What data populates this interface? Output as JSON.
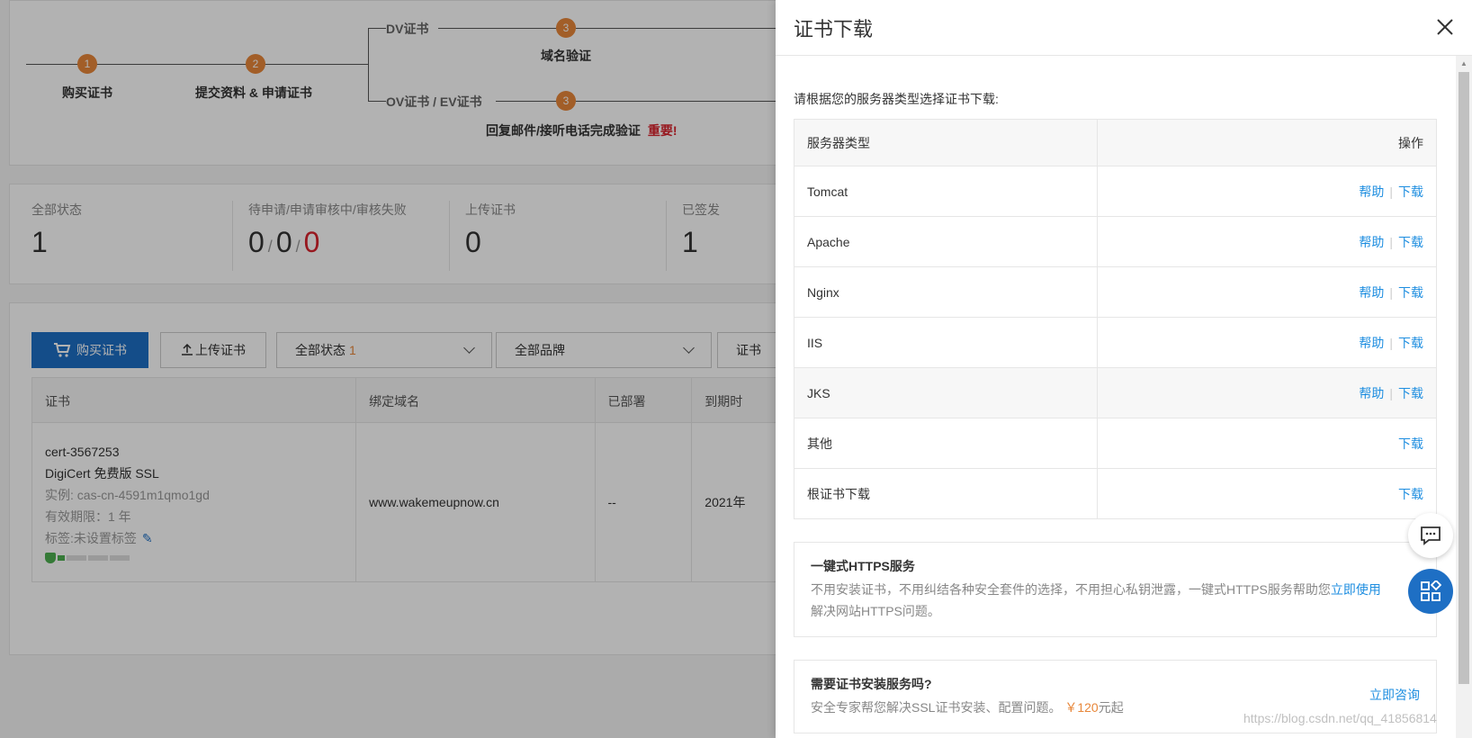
{
  "steps": {
    "step1_num": "1",
    "step1_label": "购买证书",
    "step2_num": "2",
    "step2_label": "提交资料 & 申请证书",
    "dv_label": "DV证书",
    "dv_step_num": "3",
    "dv_step_label": "域名验证",
    "ov_label": "OV证书 / EV证书",
    "ov_step_num": "3",
    "ov_step_label": "回复邮件/接听电话完成验证",
    "ov_important": "重要!"
  },
  "stats": {
    "all_label": "全部状态",
    "all_value": "1",
    "pending_label": "待申请/申请审核中/审核失败",
    "pending_a": "0",
    "pending_b": "0",
    "pending_c": "0",
    "sep": "/",
    "upload_label": "上传证书",
    "upload_value": "0",
    "issued_label": "已签发",
    "issued_value": "1"
  },
  "toolbar": {
    "buy_label": "购买证书",
    "upload_label": "上传证书",
    "status_select": "全部状态",
    "status_count": "1",
    "brand_select": "全部品牌",
    "cert_select": "证书"
  },
  "cert_table": {
    "headers": [
      "证书",
      "绑定域名",
      "已部署",
      "到期时"
    ],
    "row": {
      "id": "cert-3567253",
      "name": "DigiCert 免费版 SSL",
      "instance": "实例: cas-cn-4591m1qmo1gd",
      "validity": "有效期限：1 年",
      "tag": "标签:未设置标签",
      "domain": "www.wakemeupnow.cn",
      "deployed": "--",
      "expires": "2021年"
    }
  },
  "drawer": {
    "title": "证书下载",
    "intro": "请根据您的服务器类型选择证书下载:",
    "col_server": "服务器类型",
    "col_action": "操作",
    "help_label": "帮助",
    "download_label": "下载",
    "pipe": "|",
    "rows": [
      {
        "name": "Tomcat"
      },
      {
        "name": "Apache"
      },
      {
        "name": "Nginx"
      },
      {
        "name": "IIS"
      },
      {
        "name": "JKS"
      },
      {
        "name": "其他"
      },
      {
        "name": "根证书下载"
      }
    ],
    "https_card": {
      "title": "一键式HTTPS服务",
      "desc": "不用安装证书，不用纠结各种安全套件的选择，不用担心私钥泄露，一键式HTTPS服务帮助您",
      "desc2": "解决网站HTTPS问题。",
      "link": "立即使用"
    },
    "install_card": {
      "title": "需要证书安装服务吗?",
      "desc": "安全专家帮您解决SSL证书安装、配置问题。",
      "price": "￥120",
      "price_suffix": "元起",
      "link": "立即咨询"
    }
  },
  "watermark": "https://blog.csdn.net/qq_41856814",
  "colors": {
    "accent": "#1e6fc4",
    "link": "#1e8ee0",
    "step": "#e8873a",
    "danger": "#d9232d"
  }
}
